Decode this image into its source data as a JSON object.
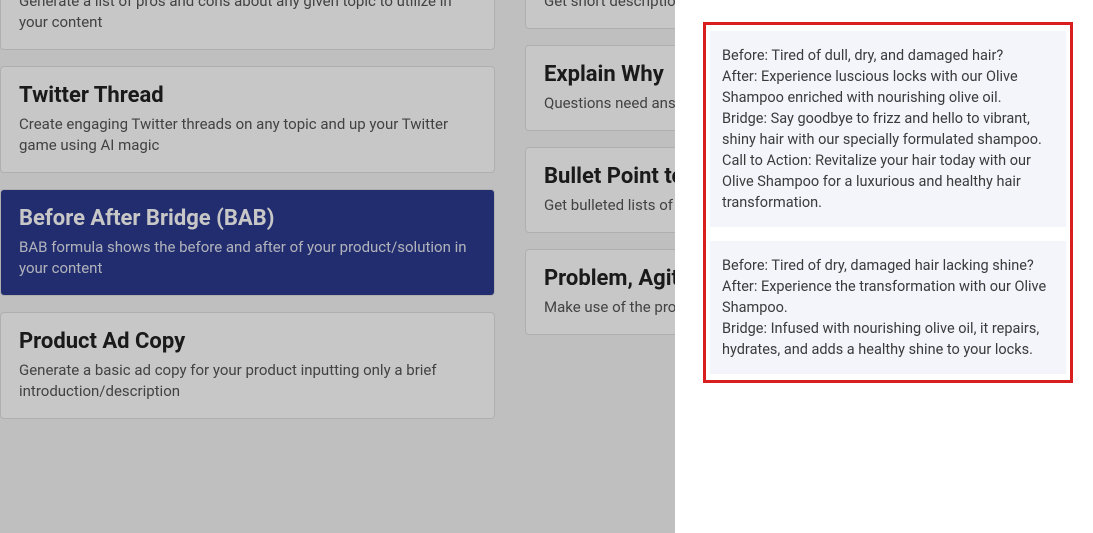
{
  "cards_left": [
    {
      "title": "",
      "desc": "Generate a list of pros and cons about any given topic to utilize in your content"
    },
    {
      "title": "Twitter Thread",
      "desc": "Create engaging Twitter threads on any topic and up your Twitter game using AI magic"
    },
    {
      "title": "Before After Bridge (BAB)",
      "desc": "BAB formula shows the before and after of your product/solution in your content"
    },
    {
      "title": "Product Ad Copy",
      "desc": "Generate a basic ad copy for your product inputting only a brief introduction/description"
    }
  ],
  "cards_right": [
    {
      "title": "",
      "desc": "Get short descriptions optimized for your d"
    },
    {
      "title": "Explain Why",
      "desc": "Questions need answers — let AI explain why"
    },
    {
      "title": "Bullet Point to",
      "desc": "Get bulleted lists of a long-form content"
    },
    {
      "title": "Problem, Agita",
      "desc": "Make use of the prov Solution (PAS)"
    }
  ],
  "results": [
    "Before: Tired of dull, dry, and damaged hair?\nAfter: Experience luscious locks with our Olive Shampoo enriched with nourishing olive oil.\nBridge: Say goodbye to frizz and hello to vibrant, shiny hair with our specially formulated shampoo.\nCall to Action: Revitalize your hair today with our Olive Shampoo for a luxurious and healthy hair transformation.",
    "Before: Tired of dry, damaged hair lacking shine?\nAfter: Experience the transformation with our Olive Shampoo.\nBridge: Infused with nourishing olive oil, it repairs, hydrates, and adds a healthy shine to your locks."
  ]
}
